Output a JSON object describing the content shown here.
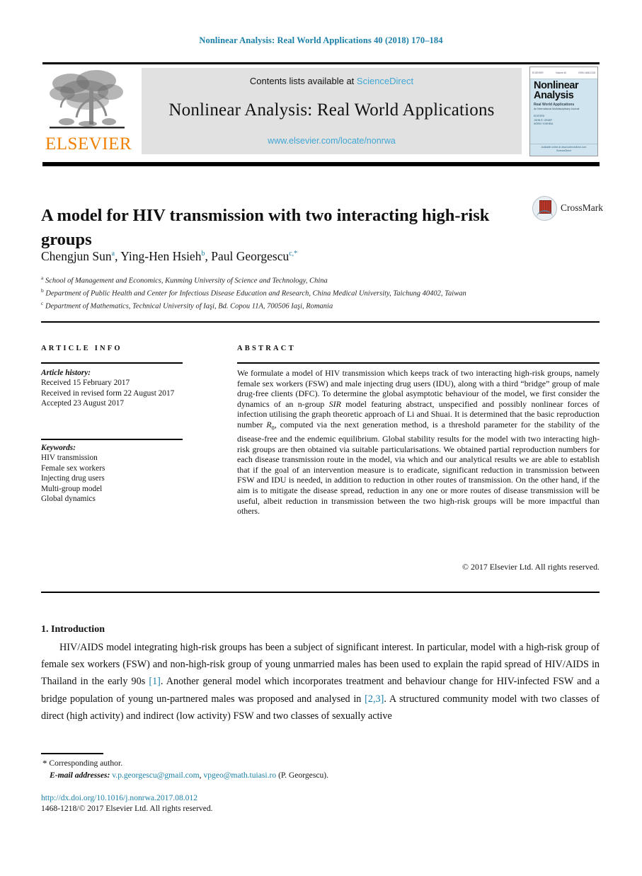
{
  "running_head": "Nonlinear Analysis: Real World Applications 40 (2018) 170–184",
  "masthead": {
    "publisher": "ELSEVIER",
    "contents_prefix": "Contents lists available at ",
    "sciencedirect": "ScienceDirect",
    "journal_title": "Nonlinear Analysis: Real World Applications",
    "journal_url": "www.elsevier.com/locate/nonrwa",
    "cover": {
      "top_left": "ELSEVIER",
      "top_mid": "Volume 40",
      "top_mid2": "April 2018",
      "top_right": "ISSN 1468-1218",
      "title_line1": "Nonlinear",
      "title_line2": "Analysis",
      "subtitle1": "Real World Applications",
      "subtitle2": "An International Multidisciplinary Journal",
      "editors_line1": "EDITORS",
      "editors_line2": "JOHN R. GRAEF",
      "editors_line3": "NORIO YOSHIDA",
      "bottom1": "Available online at www.sciencedirect.com",
      "bottom2": "ScienceDirect"
    }
  },
  "article": {
    "title": "A model for HIV transmission with two interacting high-risk groups",
    "crossmark_label": "CrossMark",
    "authors": [
      {
        "name": "Chengjun Sun",
        "sup": "a"
      },
      {
        "name": "Ying-Hen Hsieh",
        "sup": "b"
      },
      {
        "name": "Paul Georgescu",
        "sup": "c,*"
      }
    ],
    "affiliations": [
      {
        "sup": "a",
        "text": "School of Management and Economics, Kunming University of Science and Technology, China"
      },
      {
        "sup": "b",
        "text": "Department of Public Health and Center for Infectious Disease Education and Research, China Medical University, Taichung 40402, Taiwan"
      },
      {
        "sup": "c",
        "text": "Department of Mathematics, Technical University of Iaşi, Bd. Copou 11A, 700506 Iaşi, Romania"
      }
    ]
  },
  "article_info": {
    "heading": "ARTICLE INFO",
    "history_label": "Article history:",
    "history": [
      "Received 15 February 2017",
      "Received in revised form 22 August 2017",
      "Accepted 23 August 2017"
    ],
    "keywords_label": "Keywords:",
    "keywords": [
      "HIV transmission",
      "Female sex workers",
      "Injecting drug users",
      "Multi-group model",
      "Global dynamics"
    ]
  },
  "abstract": {
    "heading": "ABSTRACT",
    "part1": "We formulate a model of HIV transmission which keeps track of two interacting high-risk groups, namely female sex workers (FSW) and male injecting drug users (IDU), along with a third “bridge” group of male drug-free clients (DFC). To determine the global asymptotic behaviour of the model, we first consider the dynamics of an n-group ",
    "math1": "SIR",
    "part2": " model featuring abstract, unspecified and possibly nonlinear forces of infection utilising the graph theoretic approach of Li and Shuai. It is determined that the basic reproduction number ",
    "math2": "R",
    "math2sub": "0",
    "part3": ", computed via the next generation method, is a threshold parameter for the stability of the disease-free and the endemic equilibrium. Global stability results for the model with two interacting high-risk groups are then obtained via suitable particularisations. We obtained partial reproduction numbers for each disease transmission route in the model, via which and our analytical results we are able to establish that if the goal of an intervention measure is to eradicate, significant reduction in transmission between FSW and IDU is needed, in addition to reduction in other routes of transmission. On the other hand, if the aim is to mitigate the disease spread, reduction in any one or more routes of disease transmission will be useful, albeit reduction in transmission between the two high-risk groups will be more impactful than others.",
    "copyright": "© 2017 Elsevier Ltd. All rights reserved."
  },
  "body": {
    "section_number_title": "1. Introduction",
    "paragraph_a": "HIV/AIDS model integrating high-risk groups has been a subject of significant interest. In particular, model with a high-risk group of female sex workers (FSW) and non-high-risk group of young unmarried males has been used to explain the rapid spread of HIV/AIDS in Thailand in the early 90s ",
    "ref1": "[1]",
    "paragraph_b": ". Another general model which incorporates treatment and behaviour change for HIV-infected FSW and a bridge population of young un-partnered males was proposed and analysed in ",
    "ref2": "[2,3]",
    "paragraph_c": ". A structured community model with two classes of direct (high activity) and indirect (low activity) FSW and two classes of sexually active"
  },
  "footer": {
    "star": "*",
    "corresponding": "Corresponding author.",
    "email_label": "E-mail addresses:",
    "email1": "v.p.georgescu@gmail.com",
    "email_sep": ", ",
    "email2": "vpgeo@math.tuiasi.ro",
    "email_suffix": " (P. Georgescu).",
    "doi": "http://dx.doi.org/10.1016/j.nonrwa.2017.08.012",
    "issn": "1468-1218/© 2017 Elsevier Ltd. All rights reserved."
  },
  "colors": {
    "link": "#1a7fa8",
    "sciencedirect": "#41a7d4",
    "elsevier_orange": "#f08000"
  }
}
